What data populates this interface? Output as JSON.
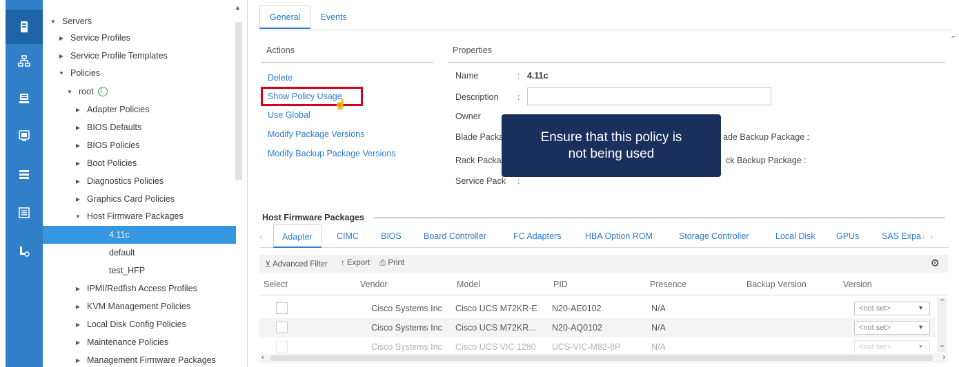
{
  "nav_rail": [
    {
      "icon": "server-icon",
      "active": true
    },
    {
      "icon": "network-icon"
    },
    {
      "icon": "storage-icon"
    },
    {
      "icon": "vm-icon"
    },
    {
      "icon": "list-icon"
    },
    {
      "icon": "log-icon"
    },
    {
      "icon": "admin-icon"
    }
  ],
  "tree": [
    {
      "label": "Servers",
      "toggle": "▼"
    },
    {
      "label": "Service Profiles",
      "toggle": "▶"
    },
    {
      "label": "Service Profile Templates",
      "toggle": "▶"
    },
    {
      "label": "Policies",
      "toggle": "▼"
    },
    {
      "label": "root",
      "toggle": "▼"
    },
    {
      "label": "Adapter Policies",
      "toggle": "▶"
    },
    {
      "label": "BIOS Defaults",
      "toggle": "▶"
    },
    {
      "label": "BIOS Policies",
      "toggle": "▶"
    },
    {
      "label": "Boot Policies",
      "toggle": "▶"
    },
    {
      "label": "Diagnostics Policies",
      "toggle": "▶"
    },
    {
      "label": "Graphics Card Policies",
      "toggle": "▶"
    },
    {
      "label": "Host Firmware Packages",
      "toggle": "▼"
    },
    {
      "label": "4.11c",
      "toggle": "",
      "selected": true
    },
    {
      "label": "default",
      "toggle": ""
    },
    {
      "label": "test_HFP",
      "toggle": ""
    },
    {
      "label": "IPMI/Redfish Access Profiles",
      "toggle": "▶"
    },
    {
      "label": "KVM Management Policies",
      "toggle": "▶"
    },
    {
      "label": "Local Disk Config Policies",
      "toggle": "▶"
    },
    {
      "label": "Maintenance Policies",
      "toggle": "▶"
    },
    {
      "label": "Management Firmware Packages",
      "toggle": "▶"
    }
  ],
  "tabs": [
    "General",
    "Events"
  ],
  "actions": {
    "title": "Actions",
    "items": [
      "Delete",
      "Show Policy Usage",
      "Use Global",
      "Modify Package Versions",
      "Modify Backup Package Versions"
    ]
  },
  "properties": {
    "title": "Properties",
    "name_label": "Name",
    "name_value": "4.11c",
    "description_label": "Description",
    "description_value": "",
    "owner_label": "Owner",
    "blade_label": "Blade Packa",
    "rack_label": "Rack Packa",
    "service_label": "Service Pack",
    "blade_backup_label": "ade Backup Package :",
    "rack_backup_label": "ck Backup Package :"
  },
  "tooltip": {
    "line1": "Ensure that this policy is",
    "line2": "not being used"
  },
  "hfp": {
    "title": "Host Firmware Packages",
    "subtabs": [
      "Adapter",
      "CIMC",
      "BIOS",
      "Board Controller",
      "FC Adapters",
      "HBA Option ROM",
      "Storage Controller",
      "Local Disk",
      "GPUs",
      "SAS Expa"
    ]
  },
  "toolbar": {
    "filter": "Advanced Filter",
    "export": "Export",
    "print": "Print"
  },
  "table": {
    "columns": [
      "Select",
      "Vendor",
      "Model",
      "PID",
      "Presence",
      "Backup Version",
      "Version"
    ],
    "rows": [
      {
        "vendor": "Cisco Systems Inc",
        "model": "Cisco UCS M72KR-E",
        "pid": "N20-AE0102",
        "presence": "N/A",
        "backup": "",
        "version": "<not set>"
      },
      {
        "vendor": "Cisco Systems Inc",
        "model": "Cisco UCS M72KR...",
        "pid": "N20-AQ0102",
        "presence": "N/A",
        "backup": "",
        "version": "<not set>"
      },
      {
        "vendor": "Cisco Systems Inc",
        "model": "Cisco UCS VIC 1280",
        "pid": "UCS-VIC-M82-8P",
        "presence": "N/A",
        "backup": "",
        "version": "<not set>"
      }
    ]
  }
}
